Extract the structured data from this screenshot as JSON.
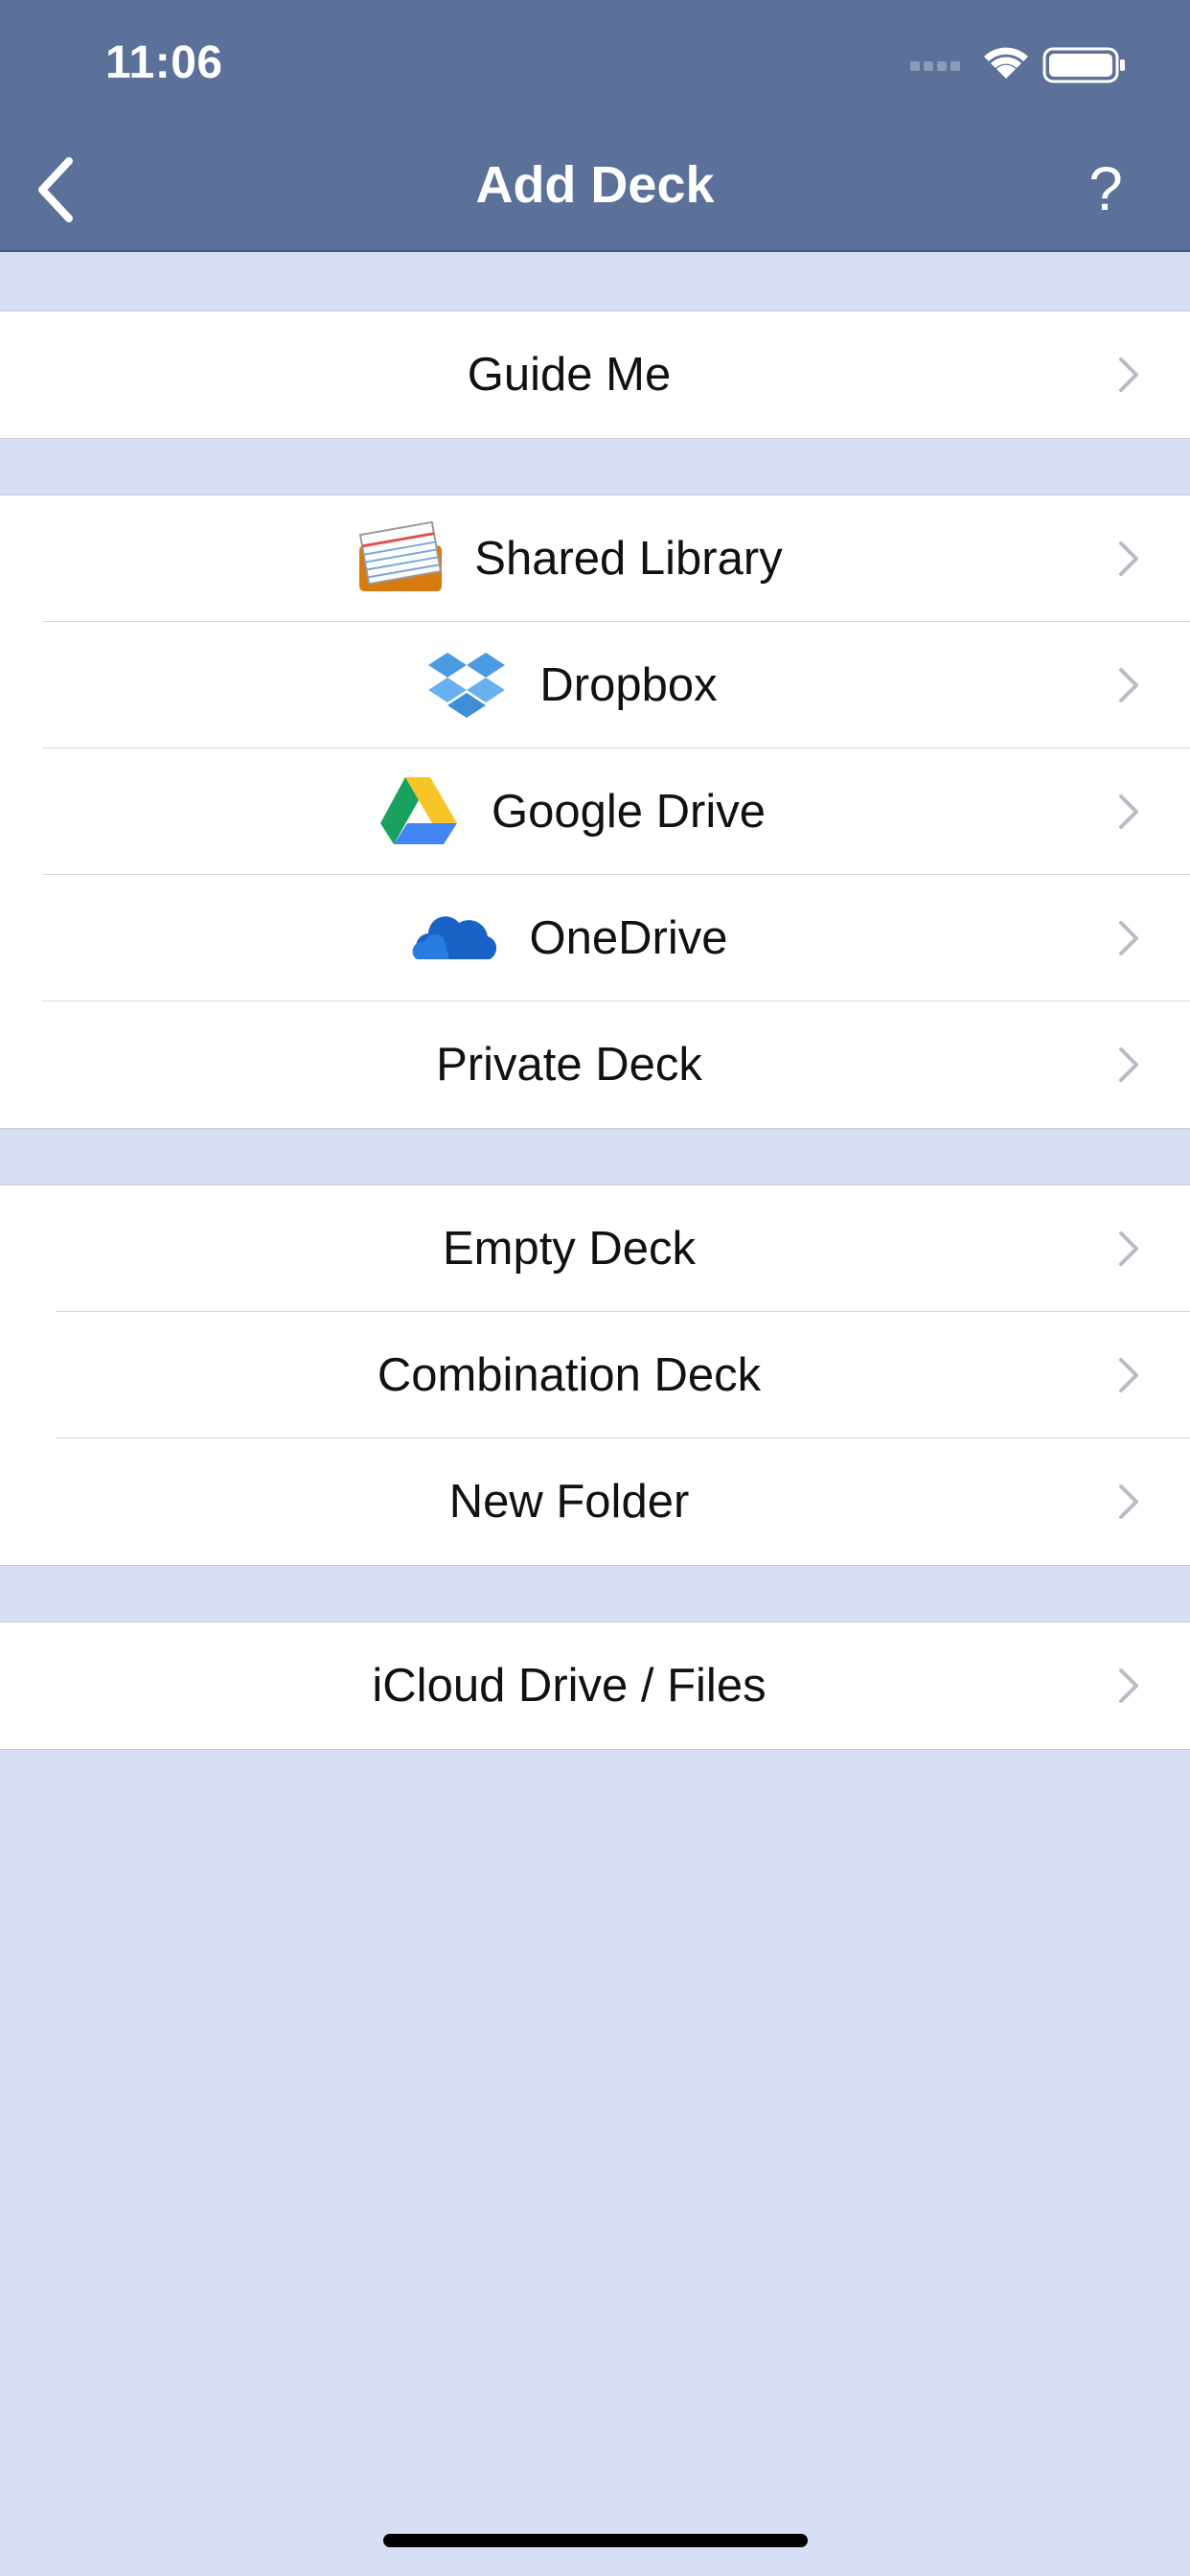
{
  "status_bar": {
    "time": "11:06"
  },
  "nav": {
    "title": "Add Deck",
    "help_label": "?"
  },
  "groups": [
    {
      "items": [
        {
          "label": "Guide Me"
        }
      ]
    },
    {
      "items": [
        {
          "label": "Shared Library",
          "icon": "flashcards-icon"
        },
        {
          "label": "Dropbox",
          "icon": "dropbox-icon"
        },
        {
          "label": "Google Drive",
          "icon": "google-drive-icon"
        },
        {
          "label": "OneDrive",
          "icon": "onedrive-icon"
        },
        {
          "label": "Private Deck"
        }
      ]
    },
    {
      "items": [
        {
          "label": "Empty Deck"
        },
        {
          "label": "Combination Deck"
        },
        {
          "label": "New Folder"
        }
      ]
    },
    {
      "items": [
        {
          "label": "iCloud Drive / Files"
        }
      ]
    }
  ],
  "colors": {
    "nav_background": "#5b7199",
    "page_background": "#d7def5",
    "row_background": "#ffffff",
    "chevron": "#b8bcc4"
  }
}
